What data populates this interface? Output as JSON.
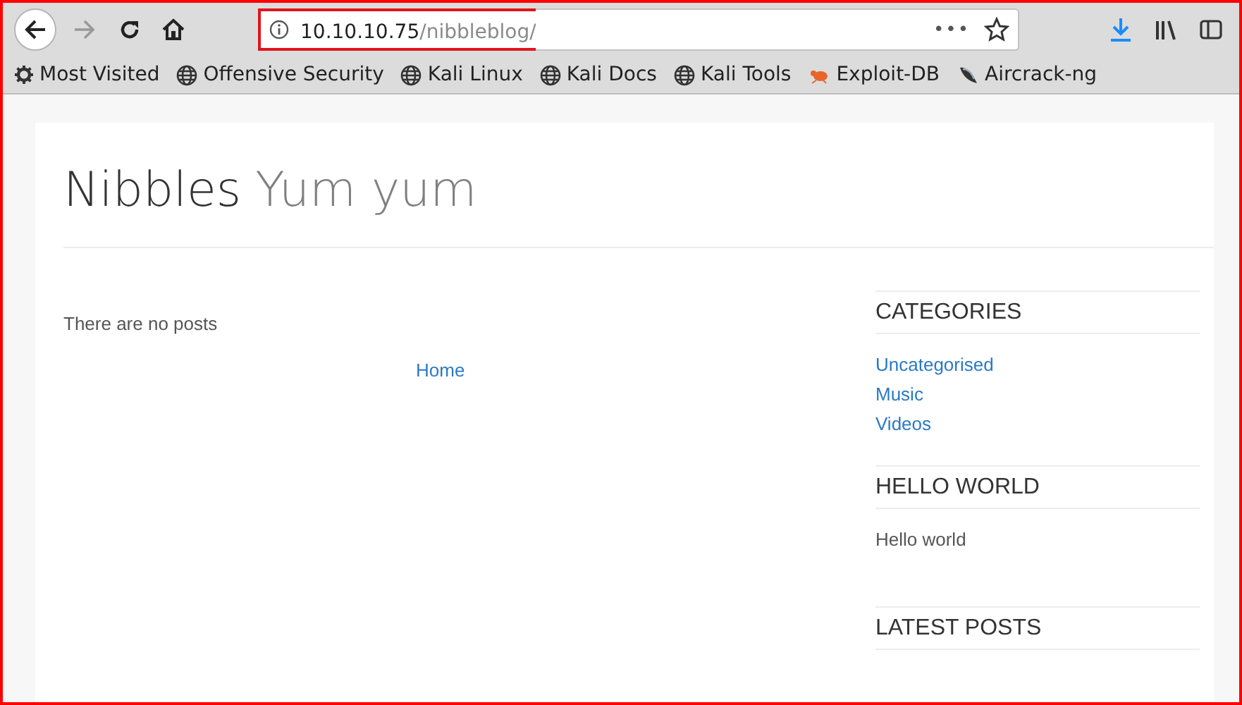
{
  "toolbar": {
    "url": {
      "host": "10.10.10.75",
      "path": "/nibbleblog/"
    },
    "page_actions": "•••"
  },
  "bookmarks": [
    {
      "label": "Most Visited",
      "kind": "gear"
    },
    {
      "label": "Offensive Security",
      "kind": "globe"
    },
    {
      "label": "Kali Linux",
      "kind": "globe"
    },
    {
      "label": "Kali Docs",
      "kind": "globe"
    },
    {
      "label": "Kali Tools",
      "kind": "globe"
    },
    {
      "label": "Exploit-DB",
      "kind": "bug"
    },
    {
      "label": "Aircrack-ng",
      "kind": "dish"
    }
  ],
  "blog": {
    "title": "Nibbles",
    "slogan": "Yum yum",
    "empty_message": "There are no posts",
    "nav_link": "Home"
  },
  "sidebar": [
    {
      "heading": "CATEGORIES",
      "kind": "links",
      "items": [
        "Uncategorised",
        "Music",
        "Videos"
      ]
    },
    {
      "heading": "HELLO WORLD",
      "kind": "text",
      "items": [
        "Hello world"
      ]
    },
    {
      "heading": "LATEST POSTS"
    }
  ]
}
